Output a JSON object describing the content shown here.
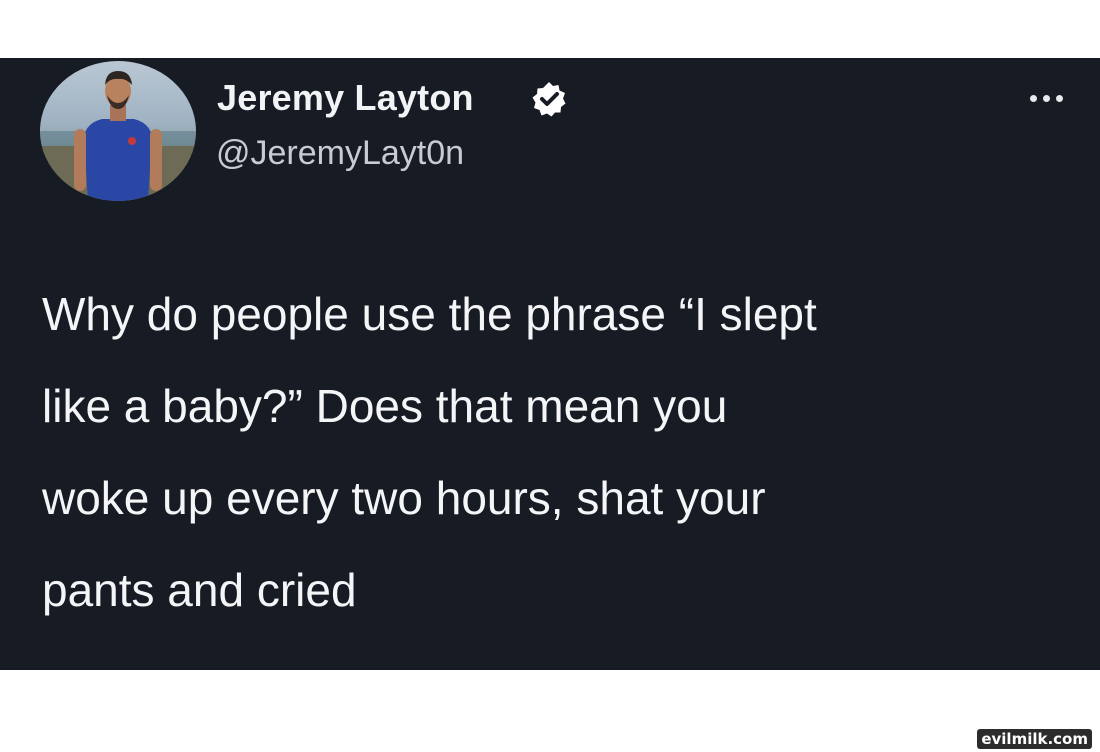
{
  "tweet": {
    "author": {
      "name": "Jeremy Layton",
      "handle": "@JeremyLayt0n",
      "verified": true
    },
    "text_lines": [
      "Why do people use the phrase “I slept",
      "like a baby?” Does that mean you",
      "woke up every two hours, shat your",
      "pants and cried"
    ],
    "more_icon": "ellipsis-icon",
    "colors": {
      "background": "#171b24",
      "text": "#f4f5f7",
      "handle": "#c8ccd2"
    }
  },
  "watermark": "evilmilk.com"
}
